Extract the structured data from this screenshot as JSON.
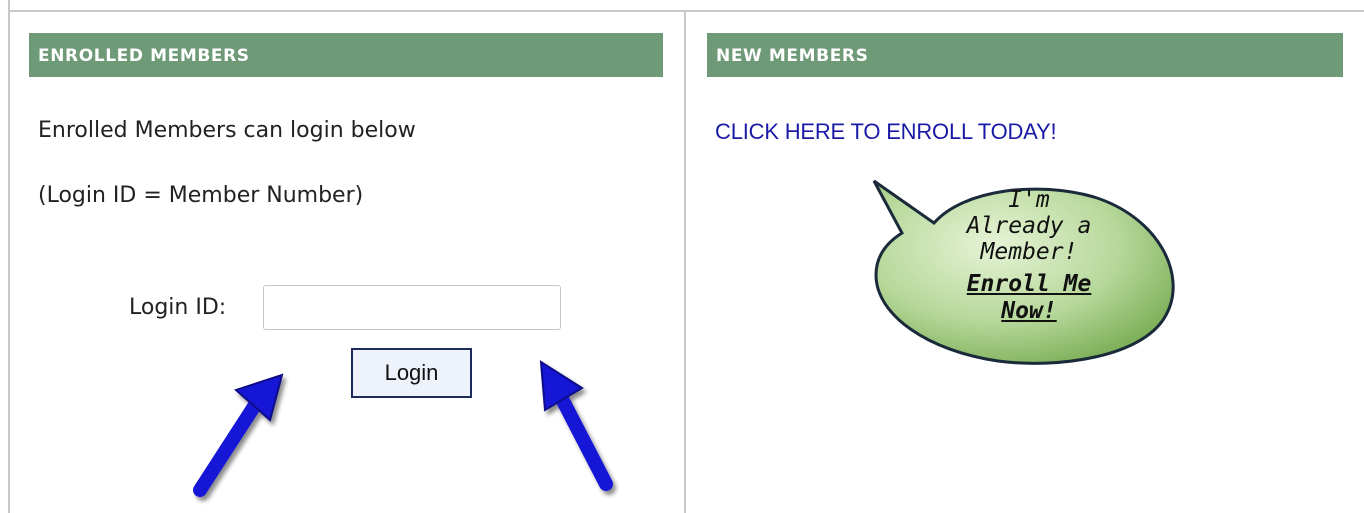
{
  "enrolled": {
    "header": "ENROLLED MEMBERS",
    "intro_line1": "Enrolled Members can login below",
    "intro_line2": "(Login ID = Member Number)",
    "login_label": "Login ID:",
    "login_value": "",
    "login_placeholder": "",
    "login_button": "Login"
  },
  "new_members": {
    "header": "NEW MEMBERS",
    "enroll_link": "CLICK HERE TO ENROLL TODAY!",
    "bubble_lines": [
      "I'm",
      "Already a",
      "Member!",
      "Enroll Me",
      "Now!"
    ]
  },
  "colors": {
    "header_bg": "#6f9a78",
    "link": "#1a1aa6",
    "arrow": "#1515d6",
    "bubble_light": "#e6f3d6",
    "bubble_dark": "#7fb05a"
  },
  "icons": [
    "arrow-up-right-icon",
    "arrow-up-left-icon",
    "speech-bubble-icon"
  ]
}
